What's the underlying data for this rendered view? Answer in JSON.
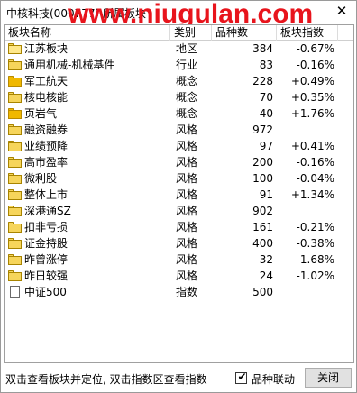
{
  "window": {
    "title": "中核科技(000777)  所属板块",
    "watermark": "www.niugulan.com",
    "close_glyph": "✕"
  },
  "columns": {
    "name": "板块名称",
    "category": "类别",
    "count": "品种数",
    "index": "板块指数"
  },
  "rows": [
    {
      "name": "江苏板块",
      "category": "地区",
      "count": "384",
      "index": "-0.67%",
      "icon": "folder-open-icon"
    },
    {
      "name": "通用机械-机械基件",
      "category": "行业",
      "count": "83",
      "index": "-0.16%",
      "icon": "folder-icon"
    },
    {
      "name": "军工航天",
      "category": "概念",
      "count": "228",
      "index": "+0.49%",
      "icon": "folder-icon"
    },
    {
      "name": "核电核能",
      "category": "概念",
      "count": "70",
      "index": "+0.35%",
      "icon": "folder-icon"
    },
    {
      "name": "页岩气",
      "category": "概念",
      "count": "40",
      "index": "+1.76%",
      "icon": "folder-icon"
    },
    {
      "name": "融资融券",
      "category": "风格",
      "count": "972",
      "index": "",
      "icon": "folder-icon"
    },
    {
      "name": "业绩预降",
      "category": "风格",
      "count": "97",
      "index": "+0.41%",
      "icon": "folder-icon"
    },
    {
      "name": "高市盈率",
      "category": "风格",
      "count": "200",
      "index": "-0.16%",
      "icon": "folder-icon"
    },
    {
      "name": "微利股",
      "category": "风格",
      "count": "100",
      "index": "-0.04%",
      "icon": "folder-icon"
    },
    {
      "name": "整体上市",
      "category": "风格",
      "count": "91",
      "index": "+1.34%",
      "icon": "folder-icon"
    },
    {
      "name": "深港通SZ",
      "category": "风格",
      "count": "902",
      "index": "",
      "icon": "folder-icon"
    },
    {
      "name": "扣非亏损",
      "category": "风格",
      "count": "161",
      "index": "-0.21%",
      "icon": "folder-icon"
    },
    {
      "name": "证金持股",
      "category": "风格",
      "count": "400",
      "index": "-0.38%",
      "icon": "folder-icon"
    },
    {
      "name": "昨曾涨停",
      "category": "风格",
      "count": "32",
      "index": "-1.68%",
      "icon": "folder-icon"
    },
    {
      "name": "昨日较强",
      "category": "风格",
      "count": "24",
      "index": "-1.02%",
      "icon": "folder-icon"
    },
    {
      "name": "中证500",
      "category": "指数",
      "count": "500",
      "index": "",
      "icon": "document-icon"
    }
  ],
  "status": {
    "hint": "双击查看板块并定位, 双击指数区查看指数",
    "checkbox_label": "品种联动",
    "checkbox_checked": true,
    "checkbox_glyph": "✔",
    "close_button": "关闭"
  }
}
